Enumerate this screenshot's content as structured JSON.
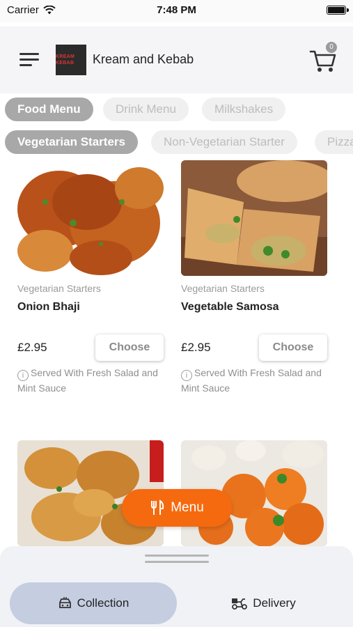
{
  "status_bar": {
    "carrier": "Carrier",
    "time": "7:48 PM"
  },
  "header": {
    "shop_name": "Kream and Kebab",
    "cart_count": "0",
    "logo_text": {
      "line1": "KREAM KEBAB",
      "line2": ""
    }
  },
  "menu_tabs": [
    {
      "label": "Food Menu",
      "active": true
    },
    {
      "label": "Drink Menu",
      "active": false
    },
    {
      "label": "Milkshakes",
      "active": false
    }
  ],
  "category_tabs": [
    {
      "label": "Vegetarian Starters",
      "active": true
    },
    {
      "label": "Non-Vegetarian Starter",
      "active": false
    },
    {
      "label": "Pizza",
      "active": false
    }
  ],
  "products": [
    {
      "category": "Vegetarian Starters",
      "name": "Onion Bhaji",
      "price": "£2.95",
      "button": "Choose",
      "description": "Served With Fresh Salad and Mint Sauce"
    },
    {
      "category": "Vegetarian Starters",
      "name": "Vegetable Samosa",
      "price": "£2.95",
      "button": "Choose",
      "description": "Served With Fresh Salad and Mint Sauce"
    }
  ],
  "fab": {
    "label": "Menu",
    "icon": "fork-knife-icon"
  },
  "bottom_sheet": {
    "collection_label": "Collection",
    "delivery_label": "Delivery"
  },
  "colors": {
    "accent": "#f56a0f",
    "chip_active": "#a8a8a8",
    "collection_bg": "#c5cde0"
  }
}
